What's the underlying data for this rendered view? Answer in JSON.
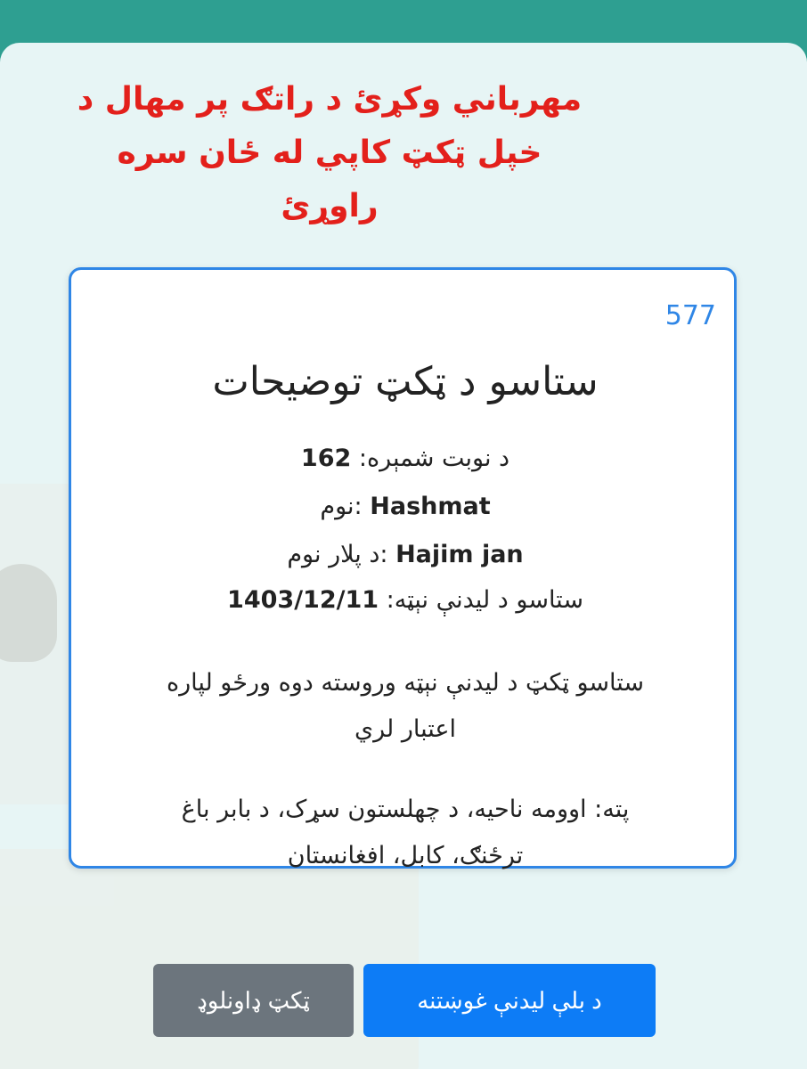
{
  "notice": {
    "line1": "مهرباني وکړئ د راتګ پر مهال د",
    "line2": "خپل ټکټ کاپي له ځان سره",
    "line3": "راوړئ"
  },
  "ticket": {
    "queue_count": "577",
    "title": "ستاسو د ټکټ توضیحات",
    "queue_number_label": "د نوبت شمېره:",
    "queue_number": "162",
    "name_label": ":نوم",
    "name": "Hashmat",
    "father_name_label": ":د پلار نوم",
    "father_name": "Hajim jan",
    "meeting_date_label": "ستاسو د لیدنې نېټه:",
    "meeting_date": "1403/12/11",
    "validity_line1": "ستاسو ټکټ د لیدنې نېټه وروسته دوه ورځو لپاره",
    "validity_line2": "اعتبار لري",
    "address_line1": "پته: اوومه ناحیه، د چهلستون سړک، د بابر باغ",
    "address_line2": "ترځنګ، کابل، افغانستان"
  },
  "buttons": {
    "request_next_meeting": "د بلې لیدنې غوښتنه",
    "download_ticket": "ټکټ ډاونلوډ"
  },
  "colors": {
    "header": "#2e9f91",
    "notice_text": "#e3201b",
    "card_border": "#2f86e6",
    "primary_button": "#0d7cf6",
    "secondary_button": "#6c757d"
  }
}
